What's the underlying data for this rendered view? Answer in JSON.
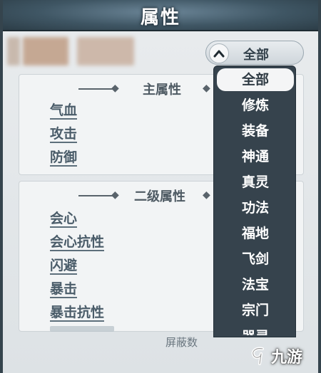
{
  "window": {
    "title": "属性"
  },
  "filter": {
    "selected_label": "全部",
    "icon": "chevron-up-icon"
  },
  "sections": [
    {
      "title": "主属性",
      "stats": [
        "气血",
        "攻击",
        "防御"
      ]
    },
    {
      "title": "二级属性",
      "stats": [
        "会心",
        "会心抗性",
        "闪避",
        "暴击",
        "暴击抗性"
      ]
    }
  ],
  "dropdown": {
    "options": [
      "全部",
      "修炼",
      "装备",
      "神通",
      "真灵",
      "功法",
      "福地",
      "飞剑",
      "法宝",
      "宗门",
      "器灵"
    ],
    "selected_index": 0
  },
  "footer": {
    "shield_text": "屏蔽数"
  },
  "watermark": {
    "text": "九游"
  },
  "colors": {
    "frame": "#35444d",
    "dropdown_bg": "#36434d",
    "stat_text": "#4a5c69"
  }
}
